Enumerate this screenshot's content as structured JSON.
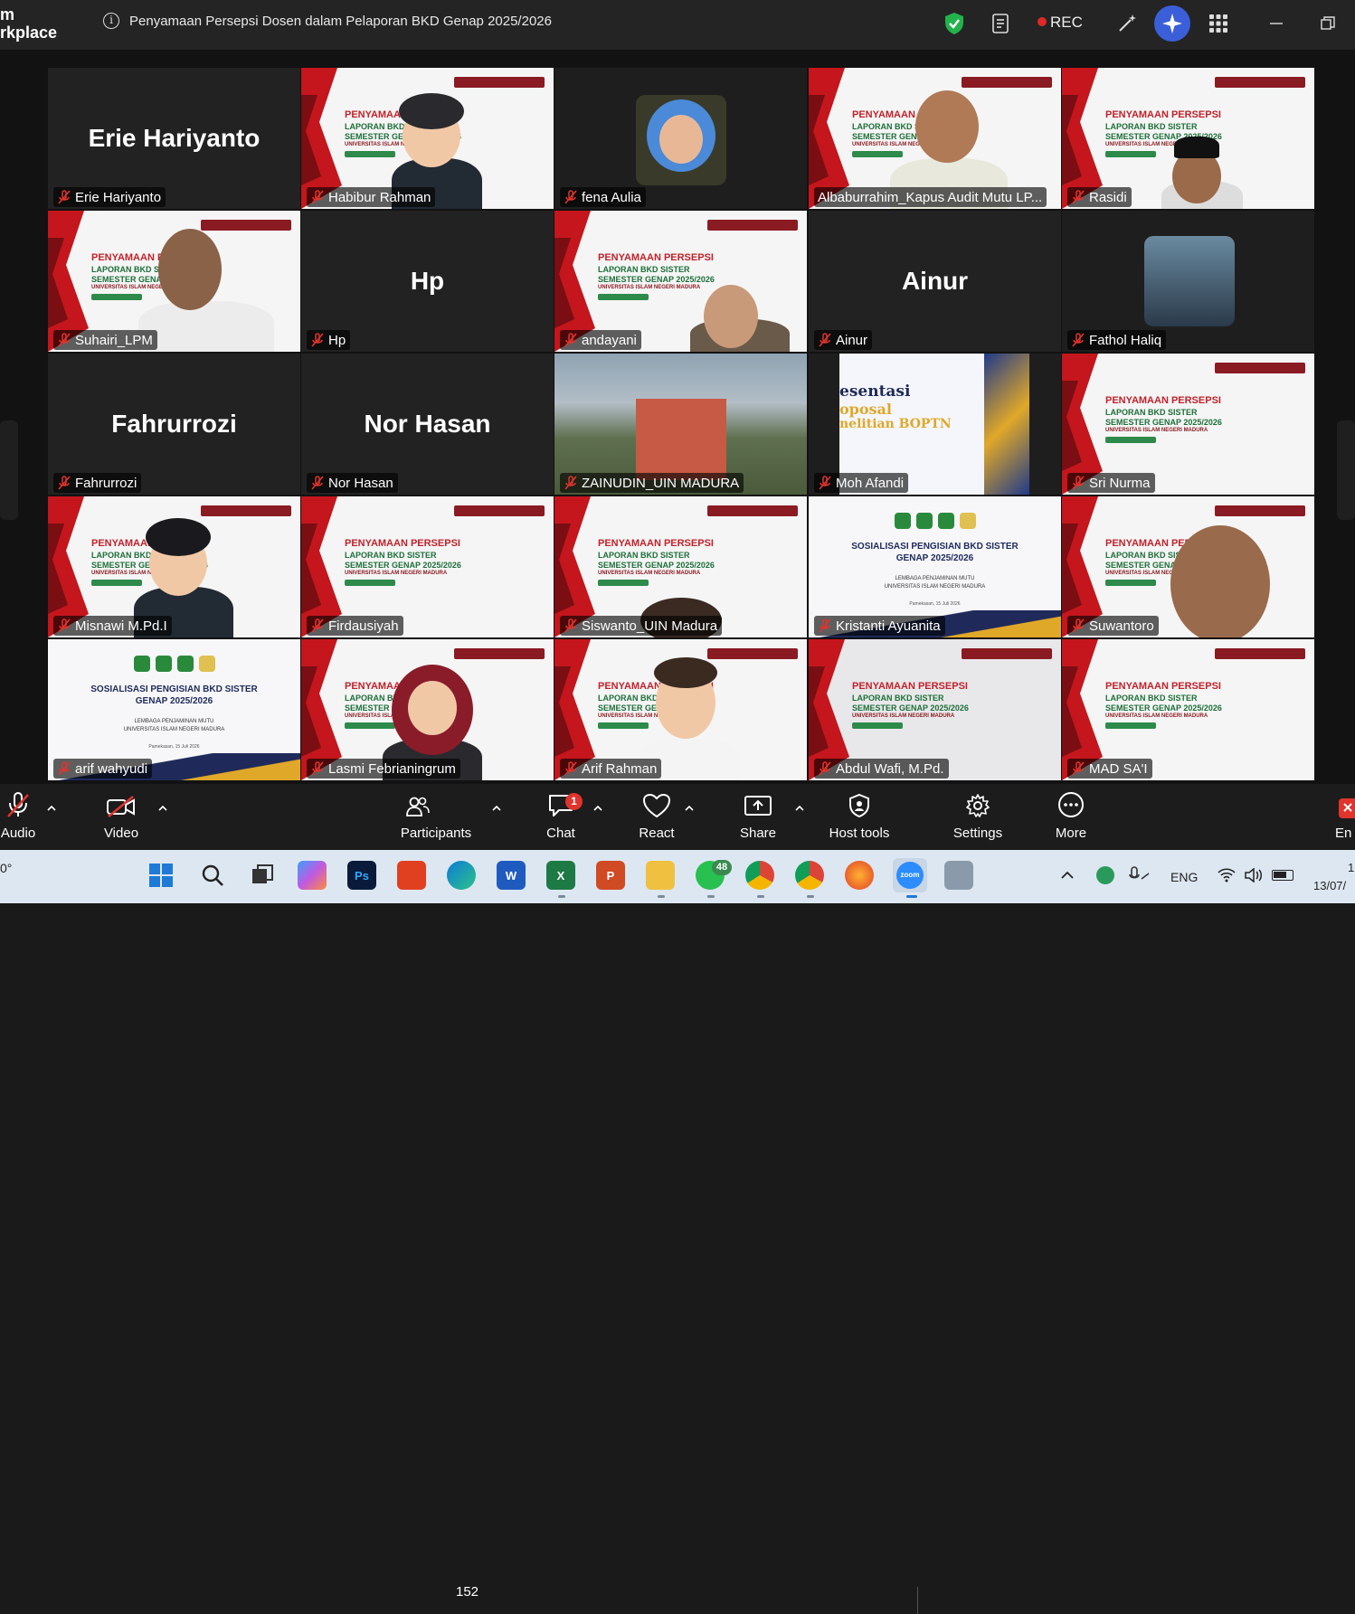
{
  "titlebar": {
    "app_name": "m\nrkplace",
    "meeting_title": "Penyamaan Persepsi Dosen dalam Pelaporan BKD Genap 2025/2026",
    "rec_label": "REC"
  },
  "slide_text": {
    "title": "PENYAMAAN PERSEPSI",
    "line2": "LAPORAN BKD SISTER",
    "line3": "SEMESTER GENAP 2025/2026",
    "line4": "UNIVERSITAS ISLAM NEGERI MADURA",
    "sos_line1": "SOSIALISASI PENGISIAN BKD SISTER",
    "sos_line2": "GENAP 2025/2026",
    "sos_line3": "LEMBAGA PENJAMINAN MUTU",
    "sos_line4": "UNIVERSITAS ISLAM NEGERI MADURA",
    "sos_line5": "Pamekasan, 15 Juli 2026"
  },
  "participants": [
    {
      "name": "Erie Hariyanto",
      "big_name": "Erie Hariyanto"
    },
    {
      "name": "Habibur Rahman"
    },
    {
      "name": "fena Aulia"
    },
    {
      "name": "Albaburrahim_Kapus Audit Mutu LP..."
    },
    {
      "name": "Rasidi"
    },
    {
      "name": "Suhairi_LPM"
    },
    {
      "name": "Hp",
      "big_name": "Hp"
    },
    {
      "name": "andayani"
    },
    {
      "name": "Ainur",
      "big_name": "Ainur"
    },
    {
      "name": "Fathol Haliq"
    },
    {
      "name": "Fahrurrozi",
      "big_name": "Fahrurrozi"
    },
    {
      "name": "Nor Hasan",
      "big_name": "Nor Hasan"
    },
    {
      "name": "ZAINUDIN_UIN MADURA"
    },
    {
      "name": "Moh Afandi"
    },
    {
      "name": "Sri Nurma"
    },
    {
      "name": "Misnawi M.Pd.I"
    },
    {
      "name": "Firdausiyah"
    },
    {
      "name": "Siswanto_UIN Madura"
    },
    {
      "name": "Kristanti Ayuanita"
    },
    {
      "name": "Suwantoro"
    },
    {
      "name": "arif wahyudi"
    },
    {
      "name": "Lasmi Febrianingrum"
    },
    {
      "name": "Arif Rahman"
    },
    {
      "name": "Abdul Wafi, M.Pd."
    },
    {
      "name": "MAD SA'I"
    }
  ],
  "afandi_slide": {
    "line1": "esentasi",
    "line2": "oposal",
    "line3": "nelitian BOPTN"
  },
  "toolbar": {
    "audio": "Audio",
    "video": "Video",
    "participants": "Participants",
    "participant_count": "152",
    "chat": "Chat",
    "chat_badge": "1",
    "react": "React",
    "share": "Share",
    "host_tools": "Host tools",
    "settings": "Settings",
    "more": "More",
    "end": "En"
  },
  "taskbar": {
    "weather": "0°",
    "lang": "ENG",
    "date": "13/07/",
    "time": "1",
    "whatsapp_badge": "48"
  },
  "colors": {
    "active_speaker": "#3ddc84",
    "rec": "#e02828",
    "badge": "#e0342d"
  }
}
